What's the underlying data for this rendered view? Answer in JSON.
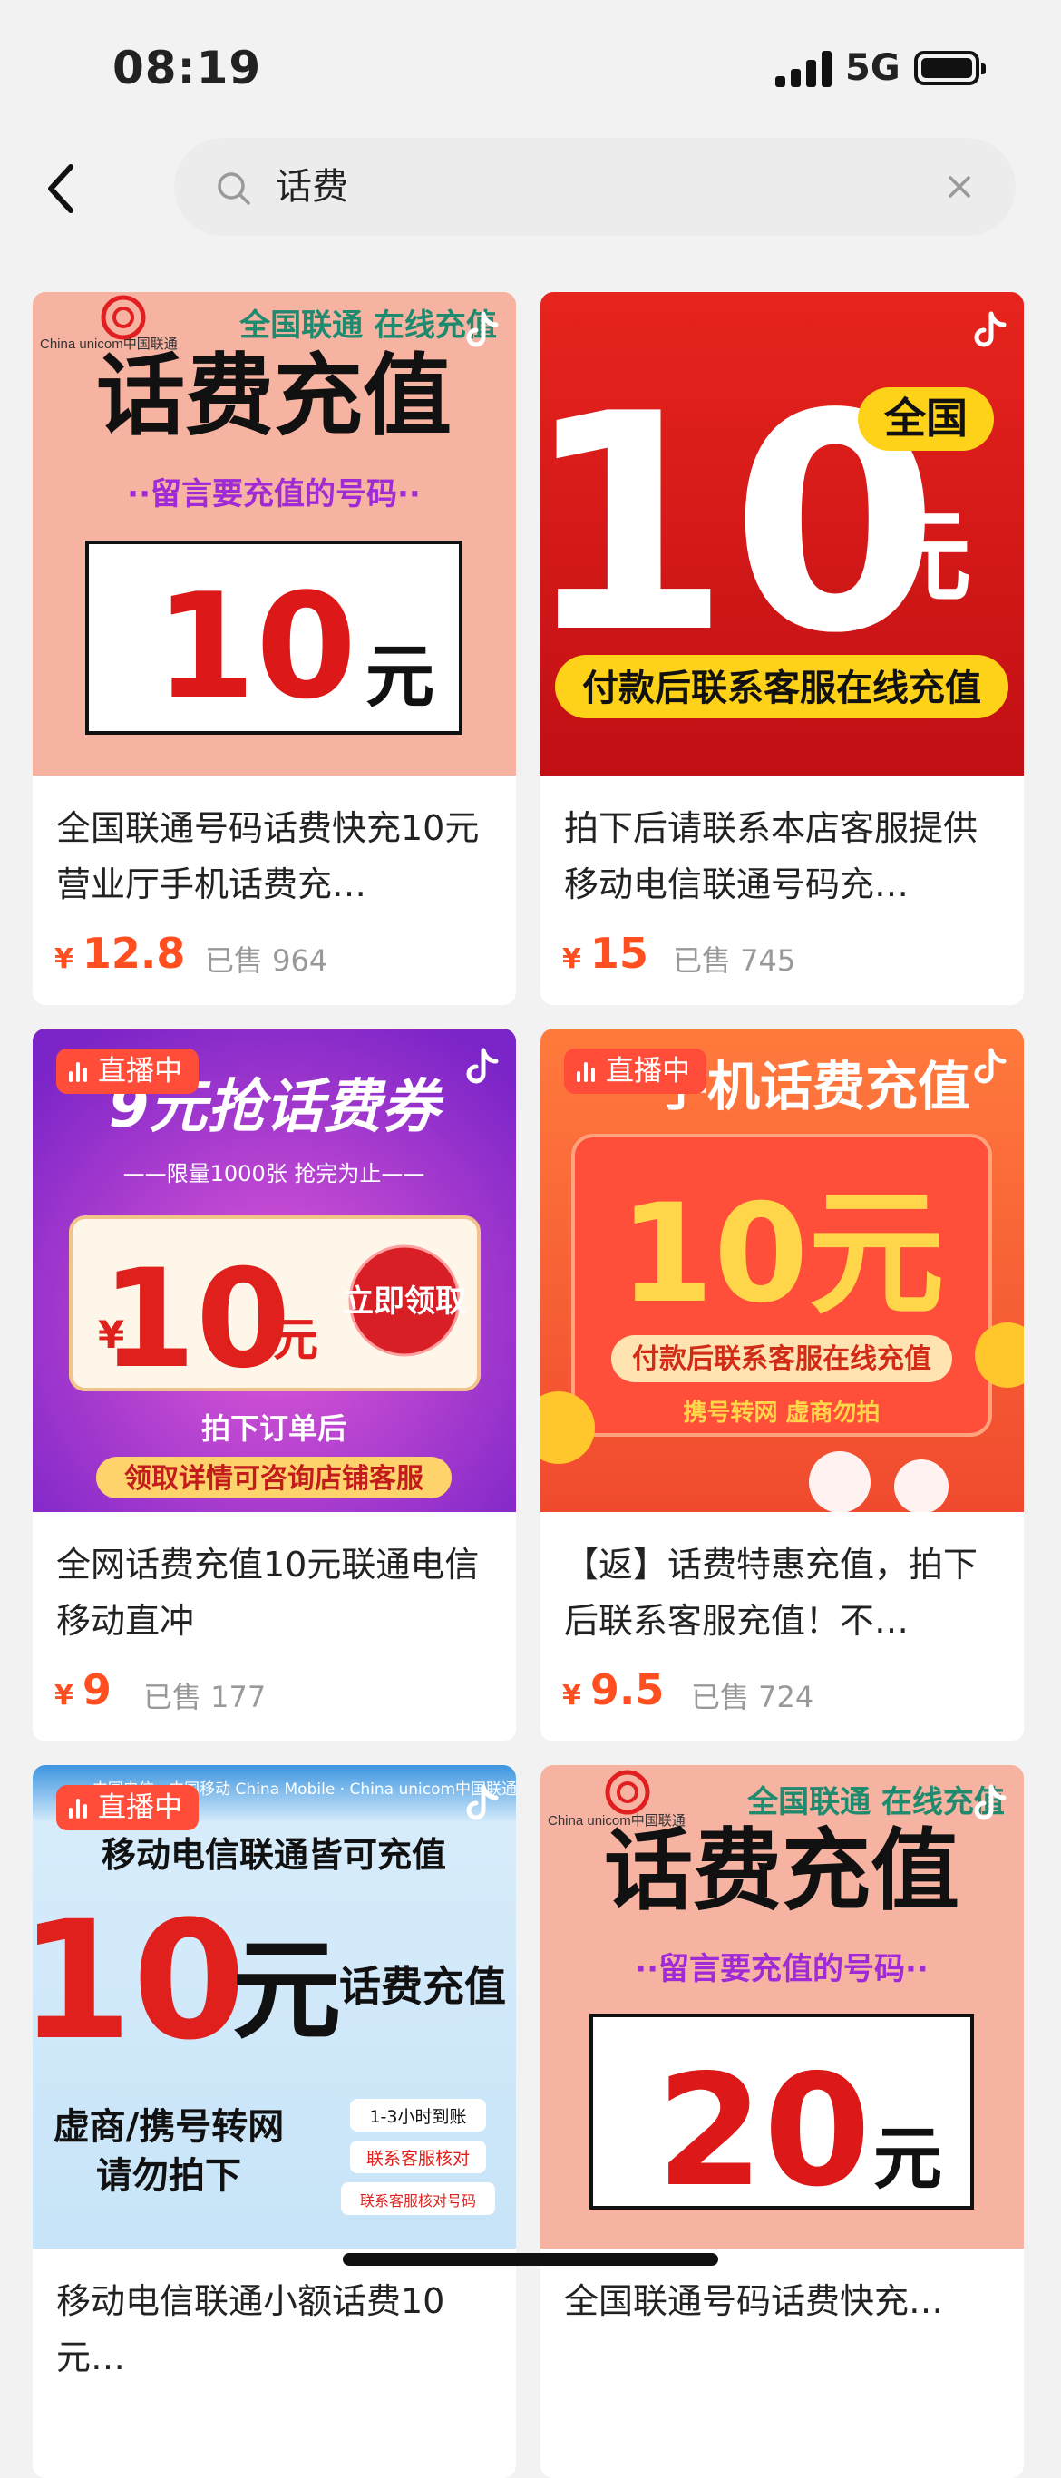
{
  "status": {
    "time": "08:19",
    "network": "5G"
  },
  "search": {
    "query": "话费"
  },
  "products": [
    {
      "title": "全国联通号码话费快充10元 营业厅手机话费充…",
      "price": "12.8",
      "sold": "已售 964",
      "live": false,
      "img": {
        "brand": "China unicom中国联通",
        "top": "全国联通  在线充值",
        "main": "话费充值",
        "sub": "··留言要充值的号码··",
        "amount": "10",
        "unit": "元"
      }
    },
    {
      "title": "拍下后请联系本店客服提供移动电信联通号码充…",
      "price": "15",
      "sold": "已售 745",
      "live": false,
      "img": {
        "amount": "10",
        "unit": "元",
        "badge": "全国",
        "banner": "付款后联系客服在线充值"
      }
    },
    {
      "title": "全网话费充值10元联通电信移动直冲",
      "price": "9",
      "sold": "已售 177",
      "live": true,
      "img": {
        "headline": "9元抢话费券",
        "limit": "——限量1000张 抢完为止——",
        "yen": "¥",
        "amount": "10",
        "unit": "元",
        "claim": "立即领取",
        "line1": "拍下订单后",
        "line2": "领取详情可咨询店铺客服"
      }
    },
    {
      "title": "【返】话费特惠充值，拍下后联系客服充值！不…",
      "price": "9.5",
      "sold": "已售 724",
      "live": true,
      "img": {
        "headline": "手机话费充值",
        "amount": "10元",
        "banner": "付款后联系客服在线充值",
        "foot": "携号转网   虚商勿拍"
      }
    },
    {
      "title": "移动电信联通小额话费10元…",
      "price": "",
      "sold": "",
      "live": true,
      "img": {
        "top": "中国电信 · 中国移动 China Mobile · China unicom中国联通",
        "main": "移动电信联通皆可充值",
        "amount": "10",
        "unit": "元",
        "side": "话费充值",
        "note1": "虚商/携号转网",
        "note2": "请勿拍下",
        "tag1": "1-3小时到账",
        "tag2": "联系客服核对",
        "tag3": "联系客服核对号码"
      }
    },
    {
      "title": "全国联通号码话费快充…",
      "price": "",
      "sold": "",
      "live": false,
      "img": {
        "brand": "China unicom中国联通",
        "top": "全国联通  在线充值",
        "main": "话费充值",
        "sub": "··留言要充值的号码··",
        "amount": "20",
        "unit": "元"
      }
    }
  ],
  "labels": {
    "yen": "¥",
    "live": "直播中"
  },
  "colors": {
    "price": "#ff4e1f",
    "live_badge": "#ff4d3a"
  }
}
